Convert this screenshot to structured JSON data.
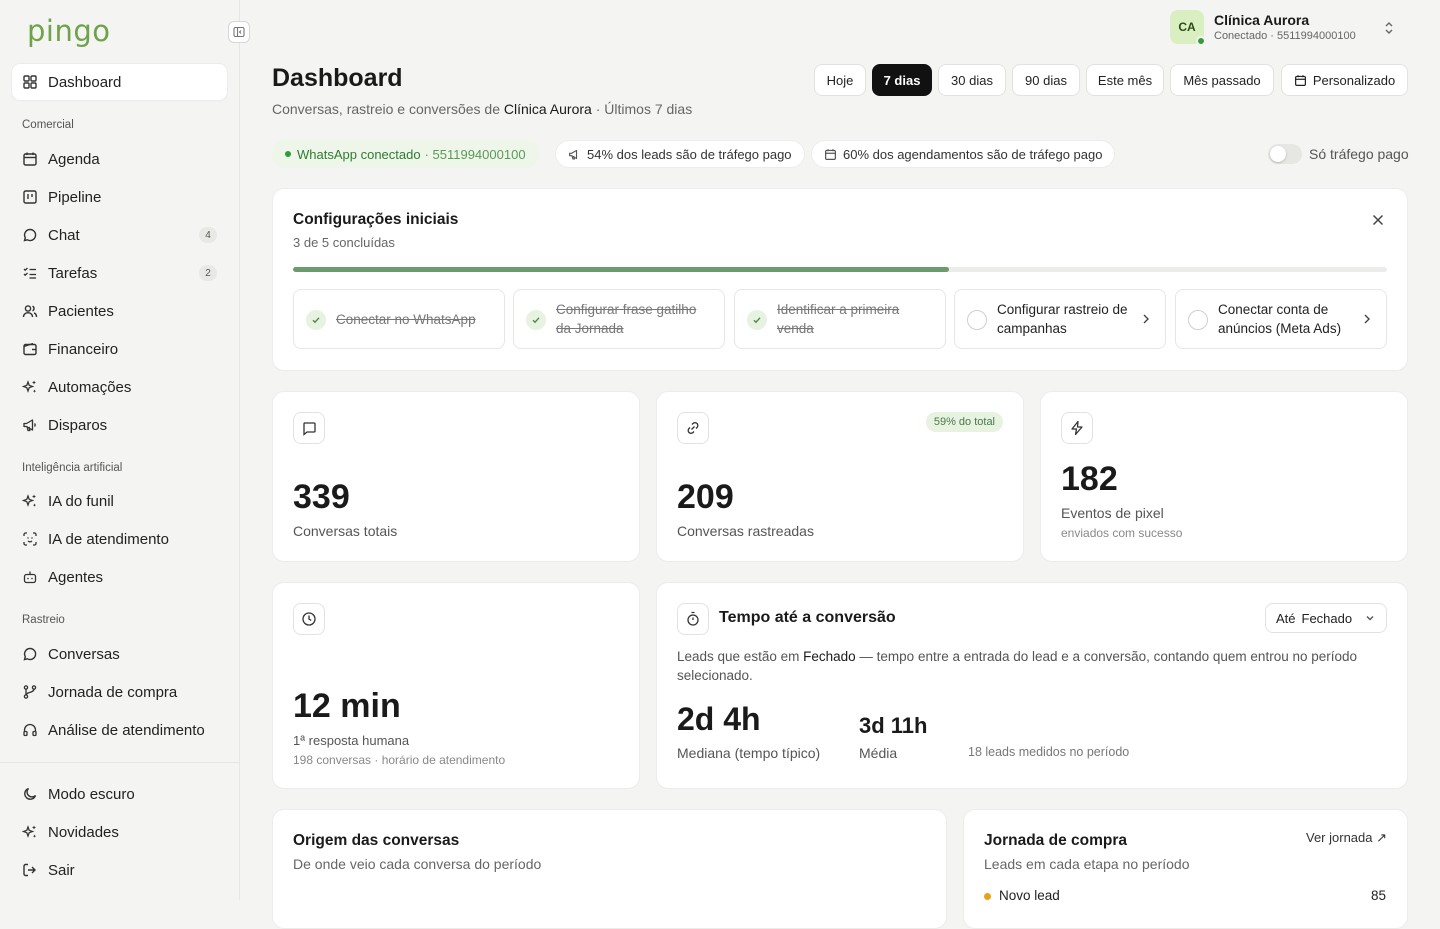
{
  "app": {
    "logo": "pingo"
  },
  "sidebar": {
    "main": {
      "label": "Dashboard",
      "icon": "layout-grid-icon"
    },
    "sections": [
      {
        "title": "Comercial",
        "items": [
          {
            "label": "Agenda",
            "icon": "calendar-icon",
            "badge": ""
          },
          {
            "label": "Pipeline",
            "icon": "kanban-icon",
            "badge": ""
          },
          {
            "label": "Chat",
            "icon": "message-circle-icon",
            "badge": "4"
          },
          {
            "label": "Tarefas",
            "icon": "list-checks-icon",
            "badge": "2"
          },
          {
            "label": "Pacientes",
            "icon": "users-icon",
            "badge": ""
          },
          {
            "label": "Financeiro",
            "icon": "wallet-icon",
            "badge": ""
          },
          {
            "label": "Automações",
            "icon": "sparkles-icon",
            "badge": ""
          },
          {
            "label": "Disparos",
            "icon": "megaphone-icon",
            "badge": ""
          }
        ]
      },
      {
        "title": "Inteligência artificial",
        "items": [
          {
            "label": "IA do funil",
            "icon": "sparkles-icon"
          },
          {
            "label": "IA de atendimento",
            "icon": "scan-face-icon"
          },
          {
            "label": "Agentes",
            "icon": "bot-icon"
          }
        ]
      },
      {
        "title": "Rastreio",
        "items": [
          {
            "label": "Conversas",
            "icon": "message-circle-icon"
          },
          {
            "label": "Jornada de compra",
            "icon": "git-branch-icon"
          },
          {
            "label": "Análise de atendimento",
            "icon": "headphones-icon"
          }
        ]
      }
    ],
    "bottom": [
      {
        "label": "Modo escuro",
        "icon": "moon-icon"
      },
      {
        "label": "Novidades",
        "icon": "sparkles-icon"
      },
      {
        "label": "Sair",
        "icon": "log-out-icon"
      }
    ]
  },
  "account": {
    "initials": "CA",
    "name": "Clínica Aurora",
    "status": "Conectado · 5511994000100"
  },
  "header": {
    "title": "Dashboard",
    "subtitle_prefix": "Conversas, rastreio e conversões de",
    "subtitle_clinic": "Clínica Aurora",
    "subtitle_suffix": "· Últimos 7 dias",
    "ranges": [
      "Hoje",
      "7 dias",
      "30 dias",
      "90 dias",
      "Este mês",
      "Mês passado",
      "Personalizado"
    ],
    "active_range": "7 dias"
  },
  "pills": {
    "whatsapp_label": "WhatsApp conectado",
    "whatsapp_number": "· 5511994000100",
    "leads_paid": "54% dos leads são de tráfego pago",
    "appointments_paid": "60% dos agendamentos são de tráfego pago",
    "toggle_label": "Só tráfego pago",
    "toggle_on": false
  },
  "setup": {
    "title": "Configurações iniciais",
    "subtitle": "3 de 5 concluídas",
    "progress": 0.6,
    "steps": [
      {
        "label": "Conectar no WhatsApp",
        "done": true
      },
      {
        "label": "Configurar frase gatilho da Jornada",
        "done": true
      },
      {
        "label": "Identificar a primeira venda",
        "done": true
      },
      {
        "label": "Configurar rastreio de campanhas",
        "done": false
      },
      {
        "label": "Conectar conta de anúncios (Meta Ads)",
        "done": false
      }
    ]
  },
  "stats": {
    "total": {
      "value": "339",
      "label": "Conversas totais",
      "icon": "message-square-icon"
    },
    "tracked": {
      "value": "209",
      "label": "Conversas rastreadas",
      "badge": "59% do total",
      "icon": "link-icon"
    },
    "pixel": {
      "value": "182",
      "label": "Eventos de pixel",
      "note": "enviados com sucesso",
      "icon": "zap-icon"
    },
    "response": {
      "value": "12 min",
      "label": "1ª resposta humana",
      "note": "198 conversas · horário de atendimento",
      "icon": "clock-icon"
    }
  },
  "conversion": {
    "title": "Tempo até a conversão",
    "select_prefix": "Até",
    "select_value": "Fechado",
    "desc_prefix": "Leads que estão em",
    "desc_stage": "Fechado",
    "desc_suffix": "— tempo entre a entrada do lead e a conversão, contando quem entrou no período selecionado.",
    "median_value": "2d 4h",
    "median_label": "Mediana (tempo típico)",
    "mean_value": "3d 11h",
    "mean_label": "Média",
    "measured": "18 leads medidos no período",
    "icon": "timer-icon"
  },
  "origin": {
    "title": "Origem das conversas",
    "subtitle": "De onde veio cada conversa do período"
  },
  "journey": {
    "title": "Jornada de compra",
    "subtitle": "Leads em cada etapa no período",
    "link": "Ver jornada ↗",
    "rows": [
      {
        "label": "Novo lead",
        "value": "85",
        "color": "#e6a11a"
      }
    ]
  }
}
